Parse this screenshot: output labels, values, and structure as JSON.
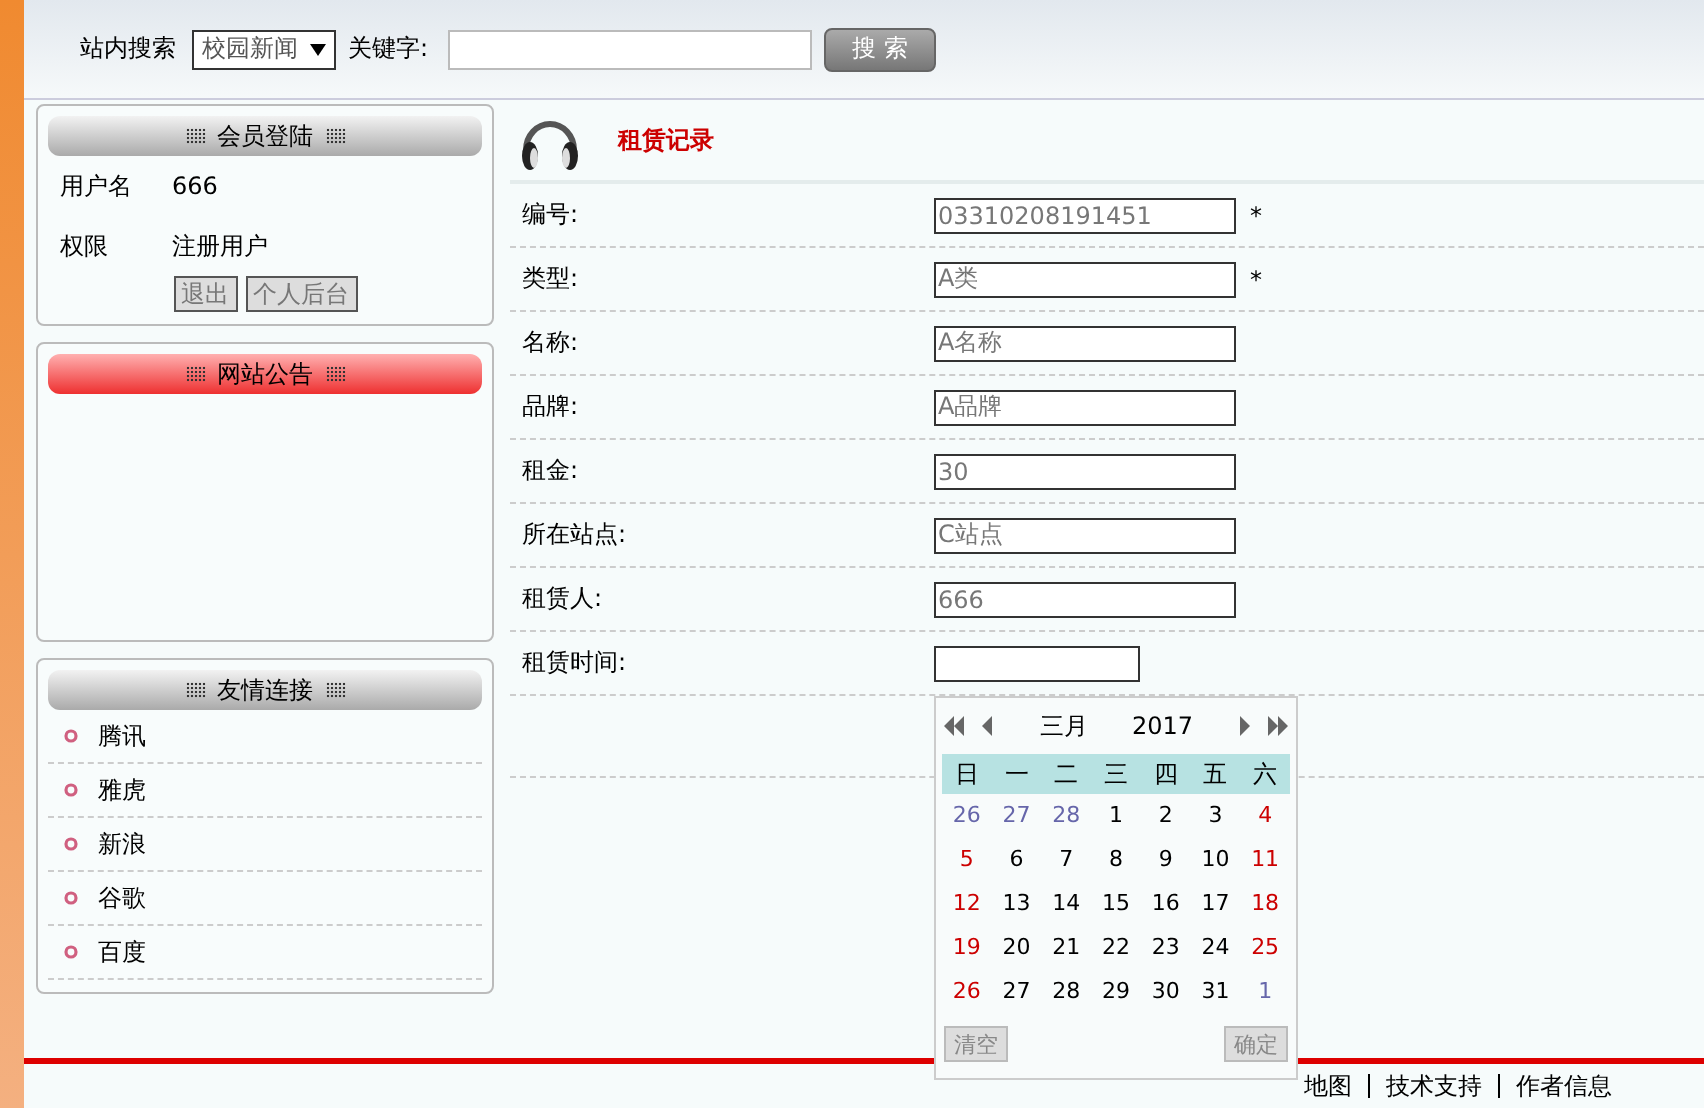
{
  "search": {
    "label": "站内搜索",
    "category": "校园新闻",
    "keyword_label": "关键字:",
    "button": "搜 索"
  },
  "login_panel": {
    "title": "会员登陆",
    "fields": [
      {
        "label": "用户名",
        "value": "666"
      },
      {
        "label": "权限",
        "value": "注册用户"
      }
    ],
    "buttons": [
      "退出",
      "个人后台"
    ]
  },
  "notice_panel": {
    "title": "网站公告"
  },
  "links_panel": {
    "title": "友情连接",
    "items": [
      "腾讯",
      "雅虎",
      "新浪",
      "谷歌",
      "百度"
    ]
  },
  "form": {
    "title": "租赁记录",
    "rows": [
      {
        "label": "编号:",
        "value": "03310208191451",
        "mark": "*",
        "kind": "text"
      },
      {
        "label": "类型:",
        "value": "A类",
        "mark": "*",
        "kind": "text"
      },
      {
        "label": "名称:",
        "value": "A名称",
        "kind": "text"
      },
      {
        "label": "品牌:",
        "value": "A品牌",
        "kind": "text"
      },
      {
        "label": "租金:",
        "value": "30",
        "kind": "text"
      },
      {
        "label": "所在站点:",
        "value": "C站点",
        "kind": "text"
      },
      {
        "label": "租赁人:",
        "value": "666",
        "kind": "text"
      },
      {
        "label": "租赁时间:",
        "kind": "date"
      }
    ]
  },
  "calendar": {
    "month": "三月",
    "year": "2017",
    "weekdays": [
      "日",
      "一",
      "二",
      "三",
      "四",
      "五",
      "六"
    ],
    "days": [
      {
        "text": "26",
        "kind": "other"
      },
      {
        "text": "27",
        "kind": "other"
      },
      {
        "text": "28",
        "kind": "other"
      },
      {
        "text": "1",
        "kind": "day"
      },
      {
        "text": "2",
        "kind": "day"
      },
      {
        "text": "3",
        "kind": "day"
      },
      {
        "text": "4",
        "kind": "weekend"
      },
      {
        "text": "5",
        "kind": "weekend"
      },
      {
        "text": "6",
        "kind": "day"
      },
      {
        "text": "7",
        "kind": "day"
      },
      {
        "text": "8",
        "kind": "day"
      },
      {
        "text": "9",
        "kind": "day"
      },
      {
        "text": "10",
        "kind": "day"
      },
      {
        "text": "11",
        "kind": "weekend"
      },
      {
        "text": "12",
        "kind": "weekend"
      },
      {
        "text": "13",
        "kind": "day"
      },
      {
        "text": "14",
        "kind": "day"
      },
      {
        "text": "15",
        "kind": "day"
      },
      {
        "text": "16",
        "kind": "day"
      },
      {
        "text": "17",
        "kind": "day"
      },
      {
        "text": "18",
        "kind": "weekend"
      },
      {
        "text": "19",
        "kind": "weekend"
      },
      {
        "text": "20",
        "kind": "day"
      },
      {
        "text": "21",
        "kind": "day"
      },
      {
        "text": "22",
        "kind": "day"
      },
      {
        "text": "23",
        "kind": "day"
      },
      {
        "text": "24",
        "kind": "day"
      },
      {
        "text": "25",
        "kind": "weekend"
      },
      {
        "text": "26",
        "kind": "weekend"
      },
      {
        "text": "27",
        "kind": "day"
      },
      {
        "text": "28",
        "kind": "day"
      },
      {
        "text": "29",
        "kind": "day"
      },
      {
        "text": "30",
        "kind": "day"
      },
      {
        "text": "31",
        "kind": "day"
      },
      {
        "text": "1",
        "kind": "other"
      }
    ],
    "buttons": [
      "清空",
      "确定"
    ]
  },
  "footer": {
    "links": [
      "地图",
      "技术支持",
      "作者信息"
    ]
  }
}
